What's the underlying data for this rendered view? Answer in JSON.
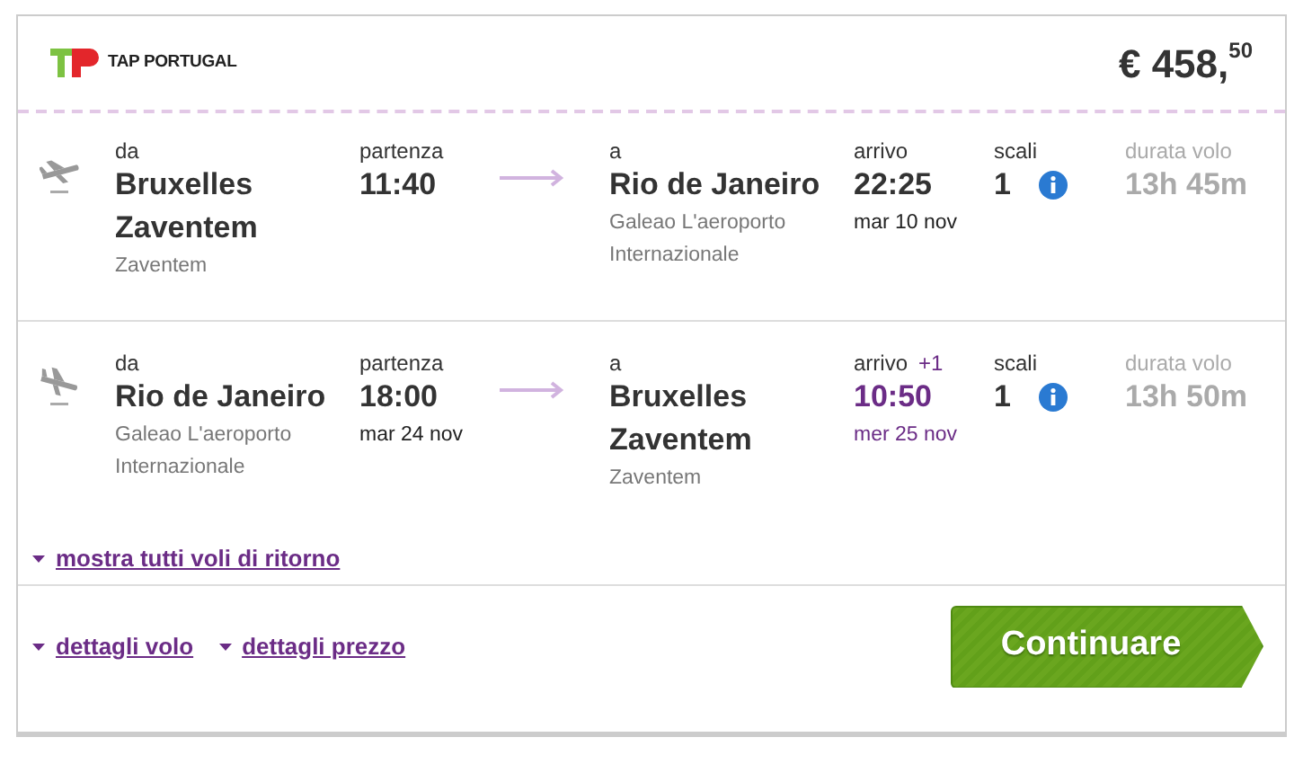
{
  "airline": {
    "name": "TAP PORTUGAL"
  },
  "price": "€ 458,$^{50}$",
  "flights": [
    {
      "kind": "outbound",
      "from_label": "da",
      "from_city": "Bruxelles Zaventem",
      "from_airport": "Zaventem",
      "dep_label": "partenza",
      "dep_time": "11:40",
      "to_label": "a",
      "to_city": "Rio de Janeiro",
      "to_airport": "Galeao L'aeroporto Internazionale",
      "arr_label": "arrivo",
      "arr_time": "22:25",
      "arr_date": "mar 10 nov",
      "next_day": false,
      "stops_label": "scali",
      "stops": "1",
      "duration_label": "durata volo",
      "duration": "13h 45m"
    },
    {
      "kind": "inbound",
      "from_label": "da",
      "from_city": "Rio de Janeiro",
      "from_airport": "Galeao L'aeroporto Internazionale",
      "dep_label": "partenza",
      "dep_time": "18:00",
      "dep_date": "mar 24 nov",
      "to_label": "a",
      "to_city": "Bruxelles Zaventem",
      "to_airport": "Zaventem",
      "arr_label": "arrivo",
      "day_offset": "+1",
      "arr_time": "10:50",
      "arr_date": "mer 25 nov",
      "next_day": true,
      "stops_label": "scali",
      "stops": "1",
      "duration_label": "durata volo",
      "duration": "13h 50m"
    }
  ],
  "show_all_link": "mostra tutti voli di ritorno",
  "footer_links": [
    "dettagli volo",
    "dettagli prezzo"
  ],
  "continue_button": "Continuare"
}
